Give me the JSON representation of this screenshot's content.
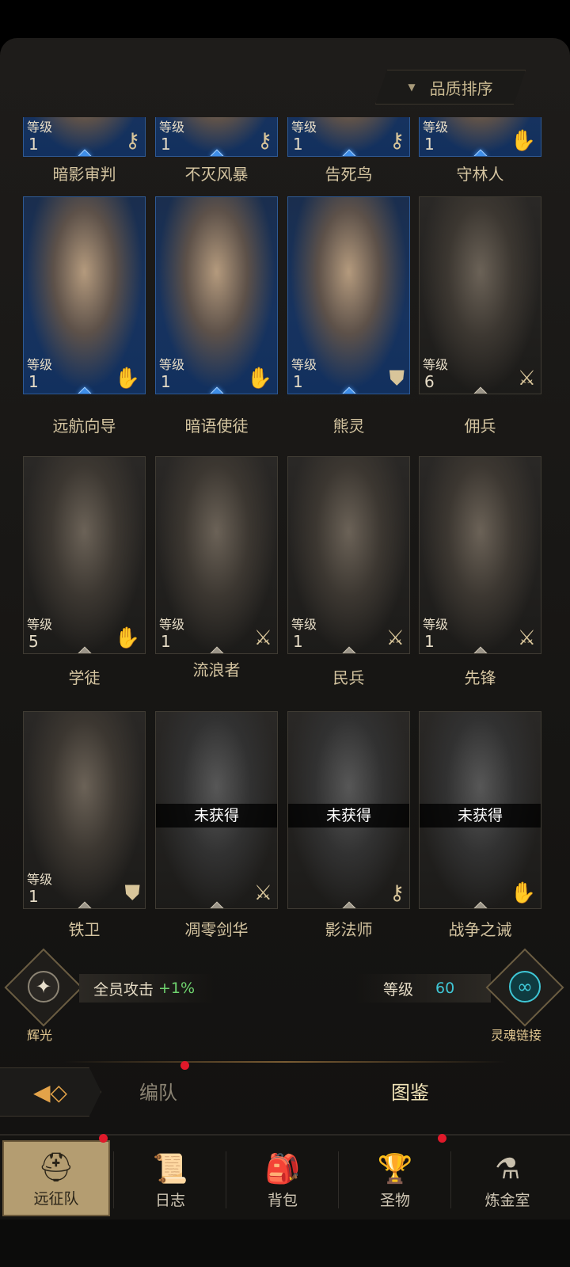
{
  "sort": {
    "label": "品质排序"
  },
  "level_label": "等级",
  "rows": [
    {
      "cards": [
        {
          "name": "暗影审判",
          "level": "1",
          "icon": "key-icon",
          "glyph": "⚷",
          "quality": "blue"
        },
        {
          "name": "不灭风暴",
          "level": "1",
          "icon": "key-icon",
          "glyph": "⚷",
          "quality": "blue"
        },
        {
          "name": "告死鸟",
          "level": "1",
          "icon": "key-icon",
          "glyph": "⚷",
          "quality": "blue"
        },
        {
          "name": "守林人",
          "level": "1",
          "icon": "hand-icon",
          "glyph": "✋",
          "quality": "blue"
        }
      ]
    },
    {
      "cards": [
        {
          "name": "远航向导",
          "level": "1",
          "icon": "hand-icon",
          "glyph": "✋",
          "quality": "blue"
        },
        {
          "name": "暗语使徒",
          "level": "1",
          "icon": "hand-icon",
          "glyph": "✋",
          "quality": "blue"
        },
        {
          "name": "熊灵",
          "level": "1",
          "icon": "shield-icon",
          "glyph": "⛊",
          "quality": "blue"
        },
        {
          "name": "佣兵",
          "level": "6",
          "icon": "sword-icon",
          "glyph": "⚔",
          "quality": "gray"
        }
      ]
    },
    {
      "cards": [
        {
          "name": "学徒",
          "level": "5",
          "icon": "hand-icon",
          "glyph": "✋",
          "quality": "gray"
        },
        {
          "name": "流浪者",
          "level": "1",
          "icon": "sword-icon",
          "glyph": "⚔",
          "quality": "gray"
        },
        {
          "name": "民兵",
          "level": "1",
          "icon": "sword-icon",
          "glyph": "⚔",
          "quality": "gray"
        },
        {
          "name": "先锋",
          "level": "1",
          "icon": "sword-icon",
          "glyph": "⚔",
          "quality": "gray"
        }
      ]
    },
    {
      "cards": [
        {
          "name": "铁卫",
          "level": "1",
          "icon": "shield-icon",
          "glyph": "⛊",
          "quality": "gray"
        },
        {
          "name": "凋零剑华",
          "locked": "未获得",
          "icon": "sword-icon",
          "glyph": "⚔",
          "quality": "locked"
        },
        {
          "name": "影法师",
          "locked": "未获得",
          "icon": "key-icon",
          "glyph": "⚷",
          "quality": "locked"
        },
        {
          "name": "战争之诫",
          "locked": "未获得",
          "icon": "hand-icon",
          "glyph": "✋",
          "quality": "locked"
        }
      ]
    }
  ],
  "buff": {
    "text": "全员攻击",
    "value": "+1%"
  },
  "radiance": {
    "label": "辉光",
    "icon": "compass-icon"
  },
  "team_level": {
    "label": "等级",
    "value": "60"
  },
  "soul_link": {
    "label": "灵魂链接",
    "icon": "chain-link-icon"
  },
  "tabs": {
    "formation": "编队",
    "codex": "图鉴"
  },
  "nav": [
    {
      "label": "远征队",
      "icon": "viking-helmet-icon",
      "glyph": "⛑",
      "active": true,
      "badge": true
    },
    {
      "label": "日志",
      "icon": "scroll-icon",
      "glyph": "📜",
      "active": false,
      "badge": false
    },
    {
      "label": "背包",
      "icon": "backpack-icon",
      "glyph": "🎒",
      "active": false,
      "badge": false
    },
    {
      "label": "圣物",
      "icon": "chalice-icon",
      "glyph": "🏆",
      "active": false,
      "badge": true
    },
    {
      "label": "炼金室",
      "icon": "alchemy-icon",
      "glyph": "⚗",
      "active": false,
      "badge": false
    }
  ],
  "colors": {
    "blue_card": "#17335f",
    "level_value": "#3fc7d6",
    "buff_value": "#6fd46f",
    "badge": "#e0192a"
  }
}
